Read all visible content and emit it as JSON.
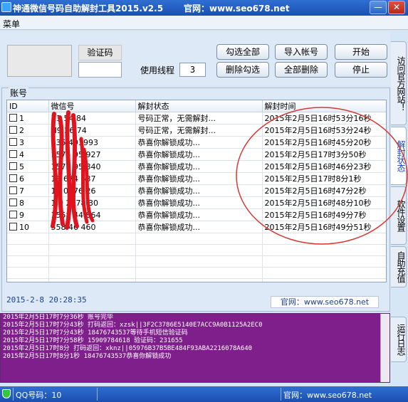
{
  "window": {
    "title": "神通微信号码自助解封工具2015.v2.5",
    "site_label": "官网：www.seo678.net",
    "minimize": "—",
    "close": "✕"
  },
  "menu": {
    "item": "菜单"
  },
  "controls": {
    "captcha_label": "验证码",
    "threads_label": "使用线程",
    "threads_value": "3",
    "select_all": "勾选全部",
    "import_accounts": "导入帐号",
    "start": "开始",
    "deselect": "删除勾选",
    "delete_all": "全部删除",
    "stop": "停止"
  },
  "list": {
    "group_title": "账号",
    "columns": [
      "ID",
      "微信号",
      "解封状态",
      "解封时间"
    ],
    "rows": [
      {
        "id": "1",
        "wx": "X1 54 84",
        "status": "号码正常，无需解封...",
        "time": "2015年2月5日16时53分16秒"
      },
      {
        "id": "2",
        "wx": "H9 26 74",
        "status": "号码正常，无需解封...",
        "time": "2015年2月5日16时53分24秒"
      },
      {
        "id": "3",
        "wx": "135 493993",
        "status": "恭喜你解锁成功...",
        "time": "2015年2月5日16时45分20秒"
      },
      {
        "id": "4",
        "wx": "1575 95 927",
        "status": "恭喜你解锁成功...",
        "time": "2015年2月5日17时3分50秒"
      },
      {
        "id": "5",
        "wx": "1575 95 840",
        "status": "恭喜你解锁成功...",
        "time": "2015年2月5日16时46分23秒"
      },
      {
        "id": "6",
        "wx": "18 674 537",
        "status": "恭喜你解锁成功...",
        "time": "2015年2月5日17时8分1秒"
      },
      {
        "id": "7",
        "wx": "18 0476 26",
        "status": "恭喜你解锁成功...",
        "time": "2015年2月5日16时47分2秒"
      },
      {
        "id": "8",
        "wx": "1 0 2778 30",
        "status": "恭喜你解锁成功...",
        "time": "2015年2月5日16时48分10秒"
      },
      {
        "id": "9",
        "wx": "1558 44 864",
        "status": "恭喜你解锁成功...",
        "time": "2015年2月5日16时49分7秒"
      },
      {
        "id": "10",
        "wx": "558 46 460",
        "status": "恭喜你解锁成功...",
        "time": "2015年2月5日16时49分51秒"
      }
    ]
  },
  "status": {
    "datetime": "2015-2-8 20:28:35",
    "site": "官网：www.seo678.net"
  },
  "log": [
    "2015年2月5日17时7分36秒  账号完毕",
    "2015年2月5日17时7分43秒  打码返回：xzsk||3F2C3786E5140E7ACC9A0B1125A2EC0",
    "2015年2月5日17时7分43秒  18476743537等待手机短信验证码",
    "2015年2月5日17时7分58秒  15909784618 验证码：231655",
    "2015年2月5日17时8分  打码返回：xknz||05976B37B5BE484F93ABA2216078A640",
    "2015年2月5日17时8分1秒  18476743537恭喜你解锁成功"
  ],
  "side_tabs": [
    "访问官方网站！",
    "解封状态",
    "软件设置",
    "自助充值",
    "运行日志"
  ],
  "footer": {
    "qq": "QQ号码：10",
    "site": "官网：www.seo678.net"
  },
  "colors": {
    "titlebar": "#1c4fb2",
    "log_background": "#7f1f8c",
    "annotation_red": "#e0141e"
  }
}
